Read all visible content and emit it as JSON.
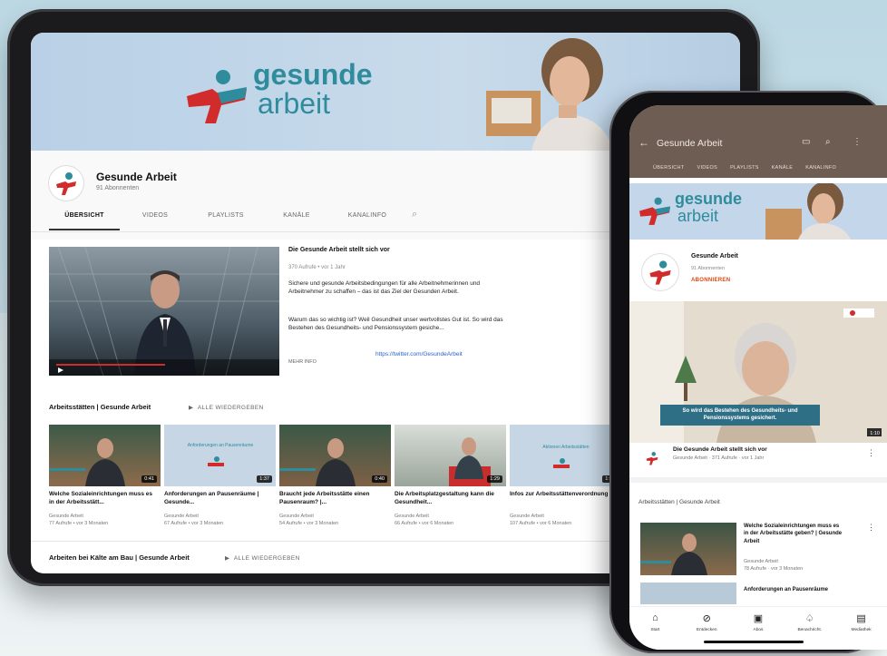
{
  "tablet": {
    "brand_line1": "gesunde",
    "brand_line2": "arbeit",
    "channel_name": "Gesunde Arbeit",
    "subscribers": "91 Abonnenten",
    "tabs": [
      "ÜBERSICHT",
      "VIDEOS",
      "PLAYLISTS",
      "KANÄLE",
      "KANALINFO"
    ],
    "featured": {
      "title": "Die Gesunde Arbeit stellt sich vor",
      "meta": "370 Aufrufe • vor 1 Jahr",
      "desc1": "Sichere und gesunde Arbeitsbedingungen für alle Arbeitnehmerinnen und Arbeitnehmer zu schaffen – das ist das Ziel der Gesunden Arbeit.",
      "desc2": "Warum das so wichtig ist? Weil Gesundheit unser wertvollstes Gut ist. So wird das Bestehen des Gesundheits- und Pensionssystem gesiche...",
      "link": "https://twitter.com/GesundeArbeit",
      "more": "MEHR INFO"
    },
    "row1": {
      "title": "Arbeitsstätten | Gesunde Arbeit",
      "play_all": "ALLE WIEDERGEBEN"
    },
    "row2": {
      "title": "Arbeiten bei Kälte am Bau | Gesunde Arbeit",
      "play_all": "ALLE WIEDERGEBEN"
    },
    "videos": [
      {
        "title": "Welche Sozialeinrichtungen muss es in der Arbeitsstätt...",
        "channel": "Gesunde Arbeit",
        "meta": "77 Aufrufe • vor 3 Monaten",
        "duration": "0:41"
      },
      {
        "title": "Anforderungen an Pausenräume | Gesunde...",
        "channel": "Gesunde Arbeit",
        "meta": "67 Aufrufe • vor 3 Monaten",
        "duration": "1:37"
      },
      {
        "title": "Braucht jede Arbeitsstätte einen Pausenraum? |...",
        "channel": "Gesunde Arbeit",
        "meta": "54 Aufrufe • vor 3 Monaten",
        "duration": "0:40"
      },
      {
        "title": "Die Arbeitsplatzgestaltung kann die Gesundheit...",
        "channel": "Gesunde Arbeit",
        "meta": "66 Aufrufe • vor 6 Monaten",
        "duration": "1:29"
      },
      {
        "title": "Infos zur Arbeitsstättenverordnung |...",
        "channel": "Gesunde Arbeit",
        "meta": "107 Aufrufe • vor 6 Monaten",
        "duration": "1:18"
      }
    ],
    "thumb_titles": [
      "Anforderungen an Pausenräume",
      "Aktionen Arbeitsstätten"
    ]
  },
  "phone": {
    "title": "Gesunde Arbeit",
    "back_icon": "←",
    "tabs": [
      "ÜBERSICHT",
      "VIDEOS",
      "PLAYLISTS",
      "KANÄLE",
      "KANALINFO"
    ],
    "brand_line1": "gesunde",
    "brand_line2": "arbeit",
    "channel_name": "Gesunde Arbeit",
    "subscribers": "91 Abonnenten",
    "subscribe": "ABONNIEREN",
    "caption": "So wird das Bestehen des Gesundheits- und Pensionssystems gesichert.",
    "video_duration": "1:10",
    "video_title": "Die Gesunde Arbeit stellt sich vor",
    "video_meta": "Gesunde Arbeit · 371 Aufrufe · vor 1 Jahr",
    "section": "Arbeitsstätten | Gesunde Arbeit",
    "row_title": "Welche Sozialeinrichtungen muss es in der Arbeitsstätte geben? | Gesunde Arbeit",
    "row_channel": "Gesunde Arbeit",
    "row_meta": "78 Aufrufe · vor 3 Monaten",
    "row2_title": "Anforderungen an Pausenräume",
    "nav": [
      "Start",
      "Entdecken",
      "Abos",
      "Benachricht.",
      "Mediathek"
    ],
    "nav_icons": [
      "⌂",
      "⊘",
      "▣",
      "♤",
      "▤"
    ]
  },
  "colors": {
    "brand_teal": "#2f8c9c",
    "brand_red": "#d22b2b",
    "phone_bar": "#6e5d52",
    "subscribe": "#d9480f"
  }
}
